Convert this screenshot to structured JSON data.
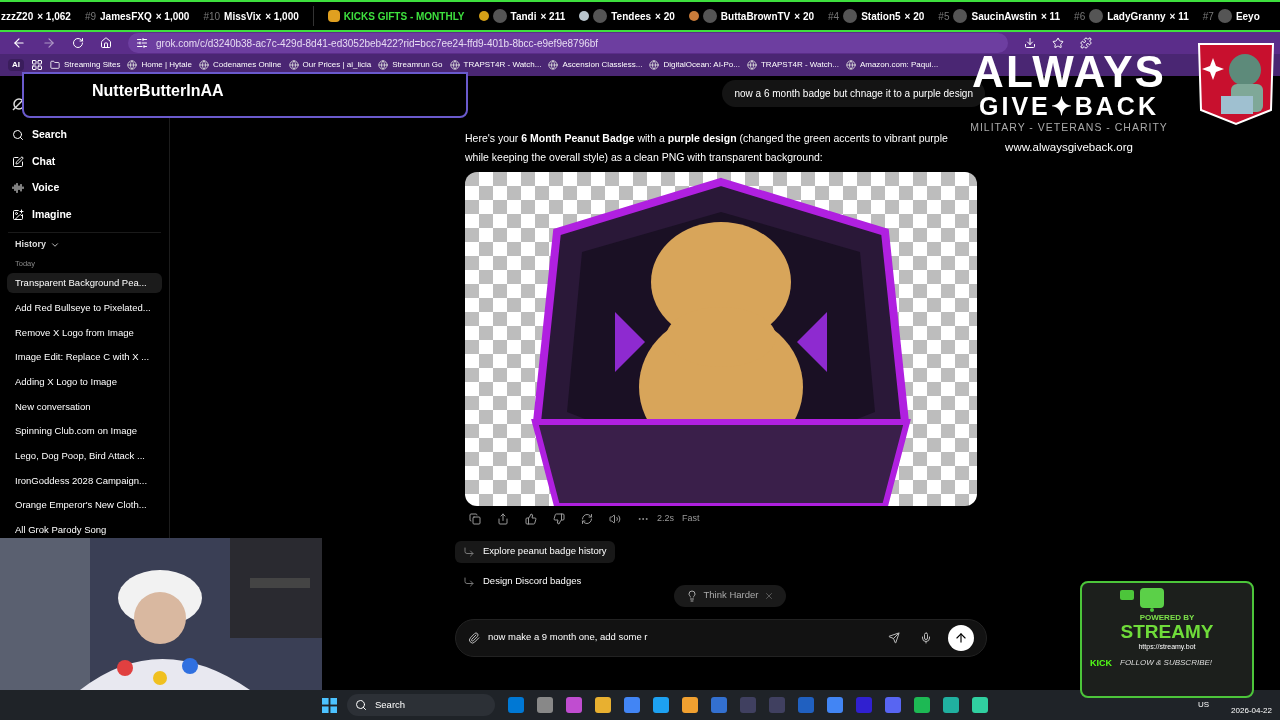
{
  "ticker": {
    "leading": [
      {
        "name": "zzzZ20",
        "count": "× 1,062"
      },
      {
        "rank": "#9",
        "name": "JamesFXQ",
        "count": "× 1,000"
      },
      {
        "rank": "#10",
        "name": "MissVix",
        "count": "× 1,000"
      }
    ],
    "heading": "KICKS GIFTS - MONTHLY",
    "trailing": [
      {
        "color": "#d4a017",
        "name": "Tandi",
        "count": "× 211"
      },
      {
        "color": "#b8c4cc",
        "name": "Tendees",
        "count": "× 20"
      },
      {
        "color": "#c97c3a",
        "name": "ButtaBrownTV",
        "count": "× 20"
      },
      {
        "rank": "#4",
        "name": "Station5",
        "count": "× 20"
      },
      {
        "rank": "#5",
        "name": "SaucinAwstin",
        "count": "× 11"
      },
      {
        "rank": "#6",
        "name": "LadyGranny",
        "count": "× 11"
      },
      {
        "rank": "#7",
        "name": "Eeyo"
      }
    ]
  },
  "browser": {
    "url": "grok.com/c/d3240b38-ac7c-429d-8d41-ed3052beb422?rid=bcc7ee24-ffd9-401b-8bcc-e9ef9e8796bf",
    "ai_button": "AI",
    "bookmarks": [
      {
        "kind": "folder",
        "label": "Streaming Sites"
      },
      {
        "kind": "site",
        "label": "Home | Hytale"
      },
      {
        "kind": "site",
        "label": "Codenames Online"
      },
      {
        "kind": "site",
        "label": "Our Prices | ai_licia"
      },
      {
        "kind": "site",
        "label": "Streamrun Go"
      },
      {
        "kind": "site",
        "label": "TRAPST4R - Watch..."
      },
      {
        "kind": "site",
        "label": "Ascension Classless..."
      },
      {
        "kind": "site",
        "label": "DigitalOcean: AI-Po..."
      },
      {
        "kind": "site",
        "label": "TRAPST4R - Watch..."
      },
      {
        "kind": "site",
        "label": "Amazon.com: Paqui..."
      }
    ]
  },
  "sidebar": {
    "nav": [
      {
        "label": "Search"
      },
      {
        "label": "Chat"
      },
      {
        "label": "Voice"
      },
      {
        "label": "Imagine"
      }
    ],
    "history_label": "History",
    "group_label": "Today",
    "history": [
      {
        "label": "Transparent Background Pea...",
        "selected": true
      },
      {
        "label": "Add Red Bullseye to Pixelated...",
        "selected": false
      },
      {
        "label": "Remove X Logo from Image",
        "selected": false
      },
      {
        "label": "Image Edit: Replace C with X ...",
        "selected": false
      },
      {
        "label": "Adding X Logo to Image",
        "selected": false
      },
      {
        "label": "New conversation",
        "selected": false
      },
      {
        "label": "Spinning Club.com on Image",
        "selected": false
      },
      {
        "label": "Lego, Dog Poop, Bird Attack ...",
        "selected": false
      },
      {
        "label": "IronGoddess 2028 Campaign...",
        "selected": false
      },
      {
        "label": "Orange Emperor's New Cloth...",
        "selected": false
      },
      {
        "label": "All Grok Parody Song",
        "selected": false
      }
    ]
  },
  "chat": {
    "user_message": "now a 6 month badge but chnage it to a purple design",
    "reply": "Here's your **6 Month Peanut Badge** with a **purple design** (changed the green accents to vibrant purple while keeping the overall style) as a clean PNG with transparent background:",
    "response_time": "2.2s",
    "mode": "Fast",
    "suggestions": [
      {
        "label": "Explore peanut badge history",
        "highlighted": true
      },
      {
        "label": "Design Discord badges",
        "highlighted": false
      }
    ],
    "chip": "Think Harder",
    "input_value": "now make a 9 month one, add some r"
  },
  "overlays": {
    "username": "NutterButterInAA",
    "charity": {
      "line1": "ALWAYS",
      "line2": "GIVE✦BACK",
      "tagline": "MILITARY - VETERANS - CHARITY",
      "url": "www.alwaysgiveback.org"
    },
    "streamy": {
      "top": "POWERED BY",
      "name": "STREAMY",
      "url": "https://streamy.bot",
      "platform": "KICK",
      "cta": "FOLLOW & SUBSCRIBE!"
    }
  },
  "taskbar": {
    "search": "Search",
    "language": "US",
    "date": "2026-04-22"
  }
}
